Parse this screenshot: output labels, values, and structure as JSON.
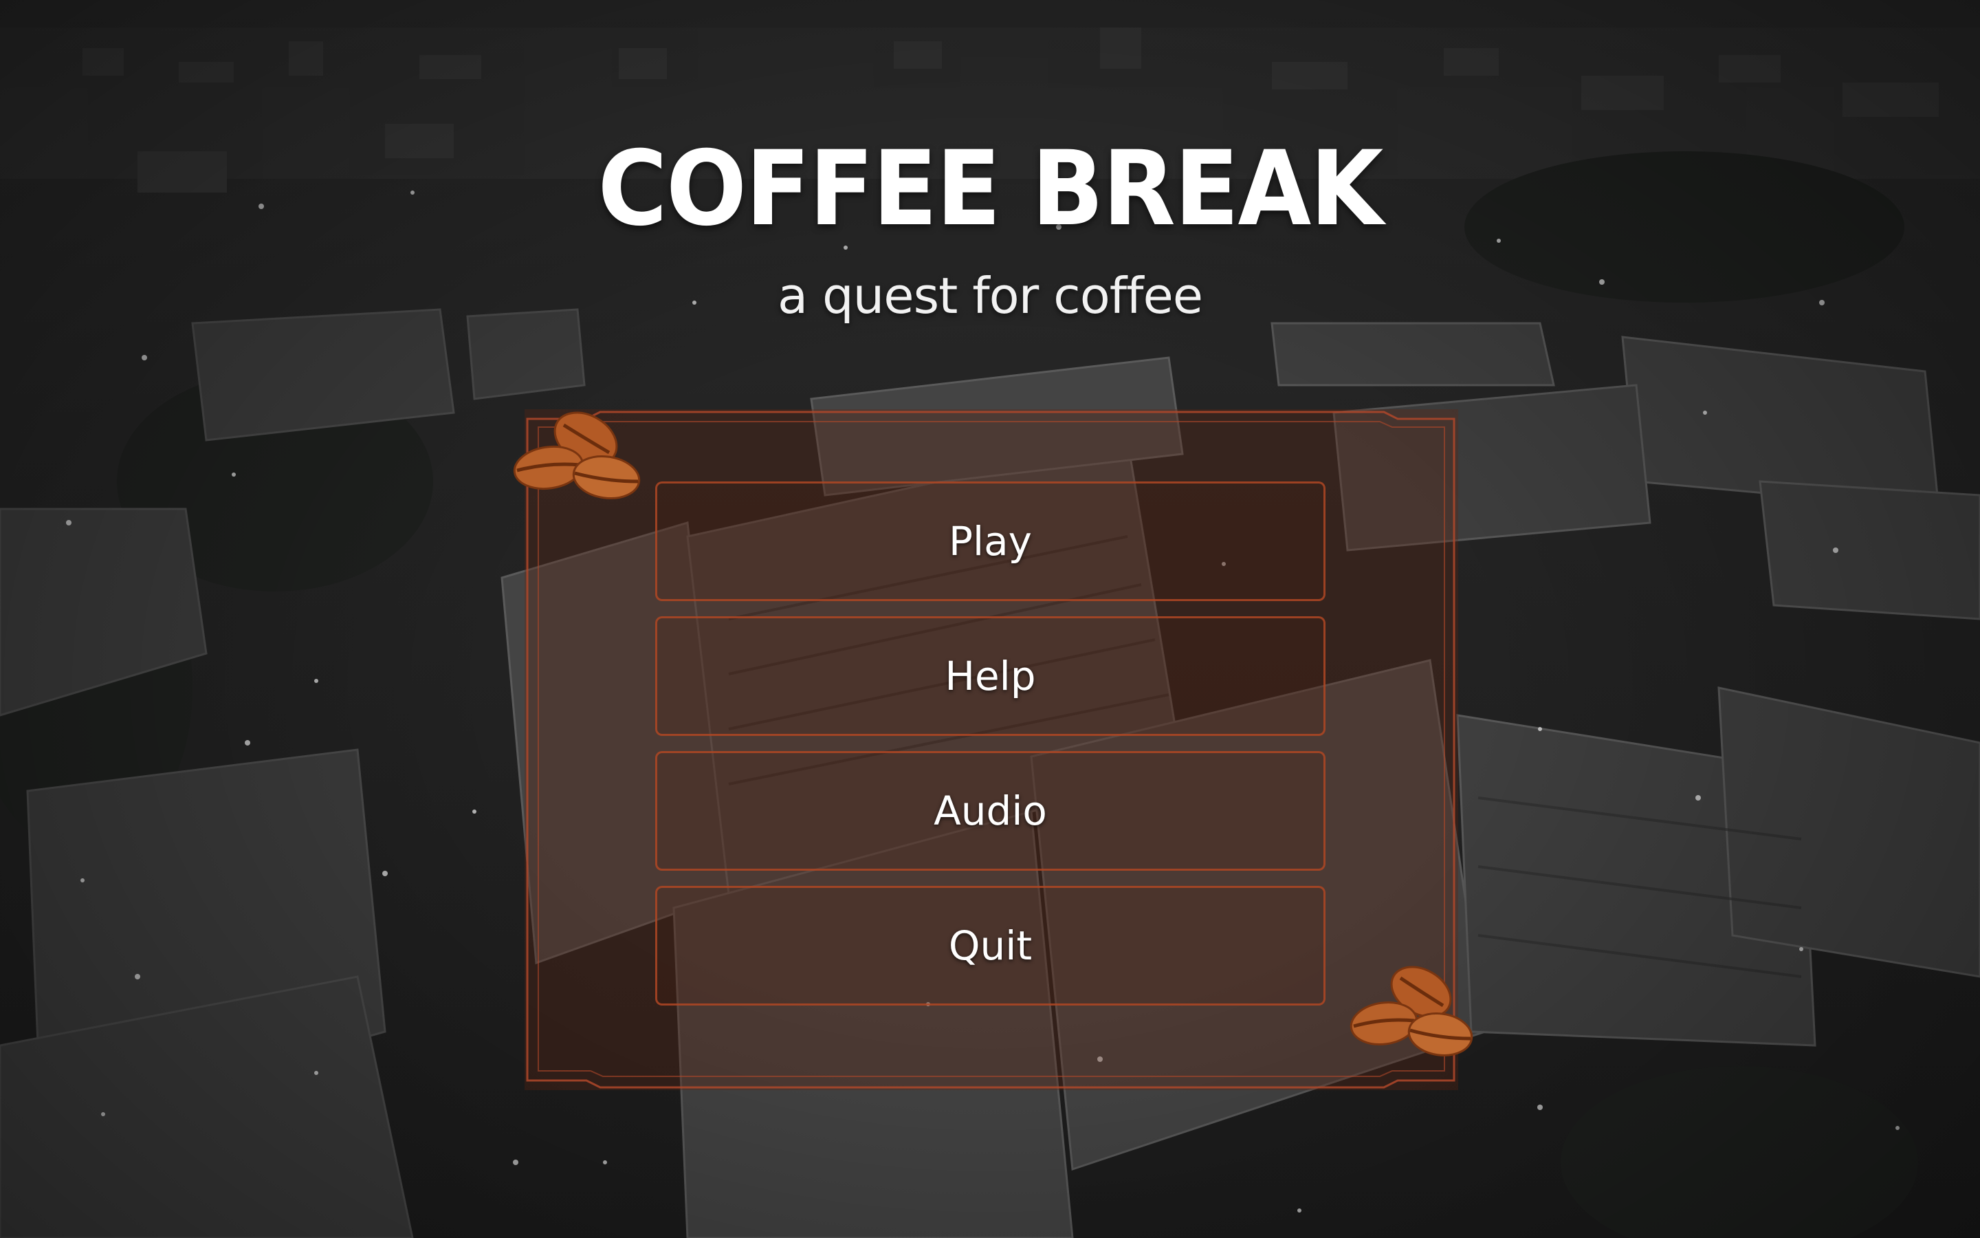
{
  "game": {
    "title": "COFFEE BREAK",
    "subtitle": "a quest for coffee"
  },
  "menu": {
    "items": [
      {
        "label": "Play"
      },
      {
        "label": "Help"
      },
      {
        "label": "Audio"
      },
      {
        "label": "Quit"
      }
    ]
  },
  "decor": {
    "top_left": "coffee-beans-icon",
    "bottom_right": "coffee-beans-icon"
  },
  "colors": {
    "accent": "#b0482a",
    "panel_tint": "#5c2612",
    "bean": "#b35a25",
    "text": "#ffffff"
  }
}
